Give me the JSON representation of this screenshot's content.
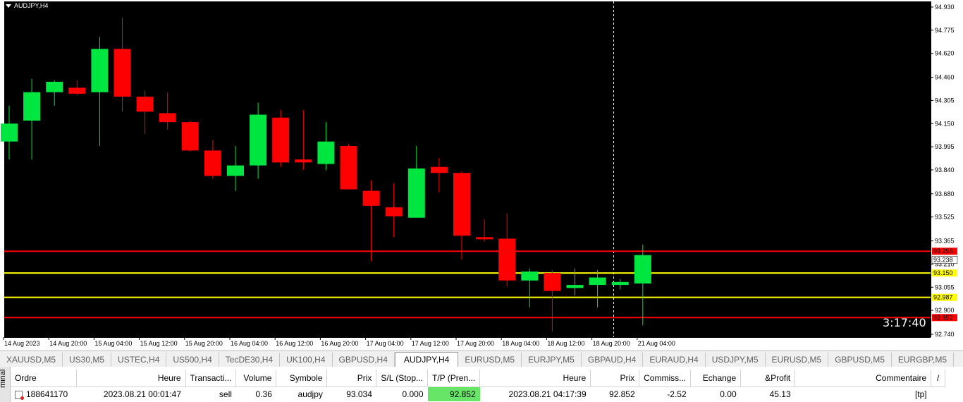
{
  "window": {
    "symbol_title": "AUDJPY,H4",
    "timer": "3:17:40"
  },
  "colors": {
    "bull": "#00e640",
    "bear": "#ff0000",
    "sl_line": "#ff0000",
    "entry_line": "#ffff00",
    "background": "#000000"
  },
  "chart_data": {
    "type": "candlestick",
    "symbol": "AUDJPY",
    "timeframe": "H4",
    "ylim": [
      92.74,
      94.93
    ],
    "price_ticks": [
      "94.930",
      "94.775",
      "94.620",
      "94.460",
      "94.305",
      "94.150",
      "93.995",
      "93.840",
      "93.680",
      "93.525",
      "93.365",
      "93.210",
      "93.055",
      "92.900",
      "92.740"
    ],
    "time_labels": [
      "14 Aug 2023",
      "14 Aug 20:00",
      "15 Aug 04:00",
      "15 Aug 12:00",
      "15 Aug 20:00",
      "16 Aug 04:00",
      "16 Aug 12:00",
      "16 Aug 20:00",
      "17 Aug 04:00",
      "17 Aug 12:00",
      "17 Aug 20:00",
      "18 Aug 04:00",
      "18 Aug 12:00",
      "18 Aug 20:00",
      "21 Aug 04:00"
    ],
    "candles": [
      {
        "o": 94.03,
        "h": 94.27,
        "l": 93.91,
        "c": 94.15
      },
      {
        "o": 94.17,
        "h": 94.45,
        "l": 93.91,
        "c": 94.36
      },
      {
        "o": 94.36,
        "h": 94.44,
        "l": 94.27,
        "c": 94.43
      },
      {
        "o": 94.39,
        "h": 94.44,
        "l": 94.34,
        "c": 94.35
      },
      {
        "o": 94.36,
        "h": 94.73,
        "l": 94.0,
        "c": 94.65
      },
      {
        "o": 94.65,
        "h": 94.86,
        "l": 94.23,
        "c": 94.33
      },
      {
        "o": 94.33,
        "h": 94.37,
        "l": 94.08,
        "c": 94.23
      },
      {
        "o": 94.22,
        "h": 94.36,
        "l": 94.11,
        "c": 94.16
      },
      {
        "o": 94.16,
        "h": 94.17,
        "l": 93.96,
        "c": 93.97
      },
      {
        "o": 93.97,
        "h": 94.04,
        "l": 93.78,
        "c": 93.8
      },
      {
        "o": 93.8,
        "h": 94.0,
        "l": 93.7,
        "c": 93.87
      },
      {
        "o": 93.87,
        "h": 94.29,
        "l": 93.78,
        "c": 94.21
      },
      {
        "o": 94.19,
        "h": 94.24,
        "l": 93.86,
        "c": 93.89
      },
      {
        "o": 93.91,
        "h": 94.24,
        "l": 93.84,
        "c": 93.89
      },
      {
        "o": 93.88,
        "h": 94.16,
        "l": 93.84,
        "c": 94.03
      },
      {
        "o": 94.0,
        "h": 94.01,
        "l": 93.71,
        "c": 93.71
      },
      {
        "o": 93.7,
        "h": 93.77,
        "l": 93.23,
        "c": 93.6
      },
      {
        "o": 93.59,
        "h": 93.75,
        "l": 93.39,
        "c": 93.53
      },
      {
        "o": 93.52,
        "h": 94.0,
        "l": 93.52,
        "c": 93.85
      },
      {
        "o": 93.86,
        "h": 93.92,
        "l": 93.69,
        "c": 93.82
      },
      {
        "o": 93.82,
        "h": 93.83,
        "l": 93.24,
        "c": 93.4
      },
      {
        "o": 93.39,
        "h": 93.51,
        "l": 93.36,
        "c": 93.38
      },
      {
        "o": 93.38,
        "h": 93.55,
        "l": 93.06,
        "c": 93.1
      },
      {
        "o": 93.1,
        "h": 93.18,
        "l": 92.92,
        "c": 93.16
      },
      {
        "o": 93.15,
        "h": 93.17,
        "l": 92.76,
        "c": 93.03
      },
      {
        "o": 93.05,
        "h": 93.18,
        "l": 93.0,
        "c": 93.07
      },
      {
        "o": 93.07,
        "h": 93.17,
        "l": 92.92,
        "c": 93.12
      },
      {
        "o": 93.07,
        "h": 93.11,
        "l": 93.04,
        "c": 93.09
      },
      {
        "o": 93.08,
        "h": 93.34,
        "l": 92.8,
        "c": 93.27
      }
    ],
    "levels": [
      {
        "price": 93.296,
        "label": "93.296",
        "color": "#ff0000"
      },
      {
        "price": 93.15,
        "label": "93.150",
        "color": "#ffff00"
      },
      {
        "price": 92.987,
        "label": "92.987",
        "color": "#ffff00"
      },
      {
        "price": 92.852,
        "label": "92.852",
        "color": "#ff0000"
      }
    ],
    "current_price": {
      "price": 93.238,
      "label": "93.238"
    },
    "cursor_time": "21 Aug 00:00"
  },
  "tabs": [
    {
      "label": "XAUUSD,M5",
      "active": false
    },
    {
      "label": "US30,M5",
      "active": false
    },
    {
      "label": "USTEC,H4",
      "active": false
    },
    {
      "label": "US500,H4",
      "active": false
    },
    {
      "label": "TecDE30,H4",
      "active": false
    },
    {
      "label": "UK100,H4",
      "active": false
    },
    {
      "label": "GBPUSD,H4",
      "active": false
    },
    {
      "label": "AUDJPY,H4",
      "active": true
    },
    {
      "label": "EURUSD,M5",
      "active": false
    },
    {
      "label": "EURJPY,M5",
      "active": false
    },
    {
      "label": "GBPAUD,H4",
      "active": false
    },
    {
      "label": "EURAUD,H4",
      "active": false
    },
    {
      "label": "USDJPY,M5",
      "active": false
    },
    {
      "label": "EURUSD,M5",
      "active": false
    },
    {
      "label": "GBPUSD,M5",
      "active": false
    },
    {
      "label": "EURGBP,M5",
      "active": false
    }
  ],
  "terminal": {
    "side_label": "minal",
    "columns": [
      "Ordre",
      "Heure",
      "Transacti...",
      "Volume",
      "Symbole",
      "Prix",
      "S/L (Stop...",
      "T/P (Pren...",
      "Heure",
      "Prix",
      "Commiss...",
      "Echange",
      "&Profit",
      "Commentaire",
      "/"
    ],
    "row": {
      "ordre": "188641170",
      "heure": "2023.08.21 00:01:47",
      "type": "sell",
      "volume": "0.36",
      "symbole": "audjpy",
      "prix": "93.034",
      "sl": "0.000",
      "tp": "92.852",
      "heure2": "2023.08.21 04:17:39",
      "prix2": "92.852",
      "commission": "-2.52",
      "echange": "0.00",
      "profit": "45.13",
      "commentaire": "[tp]"
    }
  }
}
